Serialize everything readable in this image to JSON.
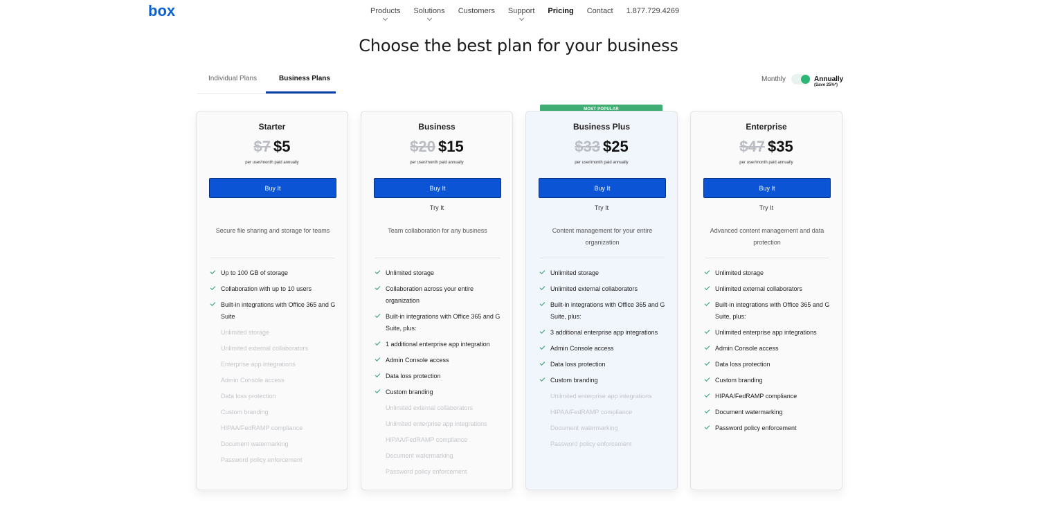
{
  "header": {
    "logo_text": "box",
    "nav": [
      {
        "label": "Products",
        "dropdown": true
      },
      {
        "label": "Solutions",
        "dropdown": true
      },
      {
        "label": "Customers",
        "dropdown": false
      },
      {
        "label": "Support",
        "dropdown": true
      },
      {
        "label": "Pricing",
        "dropdown": false,
        "active": true
      },
      {
        "label": "Contact",
        "dropdown": false
      },
      {
        "label": "1.877.729.4269",
        "dropdown": false
      }
    ]
  },
  "page_title": "Choose the best plan for your business",
  "tabs": [
    {
      "label": "Individual Plans",
      "active": false
    },
    {
      "label": "Business Plans",
      "active": true
    }
  ],
  "billing": {
    "monthly_label": "Monthly",
    "annually_label": "Annually",
    "save_note": "(Save 25%*)",
    "selected": "annually"
  },
  "colors": {
    "accent_blue": "#0b54d6",
    "tab_underline": "#0b3fa8",
    "toggle_green": "#2bb673",
    "badge_green": "#3fad74",
    "check_green": "#2a9c68"
  },
  "plans": [
    {
      "name": "Starter",
      "old_price": "$7",
      "price": "$5",
      "per": "per user/month paid annually",
      "buy_label": "Buy It",
      "try_label": "",
      "description": "Secure file sharing and storage for teams",
      "features": [
        {
          "text": "Up to 100 GB of storage",
          "included": true
        },
        {
          "text": "Collaboration with up to 10 users",
          "included": true
        },
        {
          "text": "Built-in integrations with Office 365 and G Suite",
          "included": true
        },
        {
          "text": "Unlimited storage",
          "included": false
        },
        {
          "text": "Unlimited external collaborators",
          "included": false
        },
        {
          "text": "Enterprise app integrations",
          "included": false
        },
        {
          "text": "Admin Console access",
          "included": false
        },
        {
          "text": "Data loss protection",
          "included": false
        },
        {
          "text": "Custom branding",
          "included": false
        },
        {
          "text": "HIPAA/FedRAMP compliance",
          "included": false
        },
        {
          "text": "Document watermarking",
          "included": false
        },
        {
          "text": "Password policy enforcement",
          "included": false
        }
      ]
    },
    {
      "name": "Business",
      "old_price": "$20",
      "price": "$15",
      "per": "per user/month paid annually",
      "buy_label": "Buy It",
      "try_label": "Try It",
      "description": "Team collaboration for any business",
      "features": [
        {
          "text": "Unlimited storage",
          "included": true
        },
        {
          "text": "Collaboration across your entire organization",
          "included": true
        },
        {
          "text": "Built-in integrations with Office 365 and G Suite, plus:",
          "included": true
        },
        {
          "text": "1 additional enterprise app integration",
          "included": true
        },
        {
          "text": "Admin Console access",
          "included": true
        },
        {
          "text": "Data loss protection",
          "included": true
        },
        {
          "text": "Custom branding",
          "included": true
        },
        {
          "text": "Unlimited external collaborators",
          "included": false
        },
        {
          "text": "Unlimited enterprise app integrations",
          "included": false
        },
        {
          "text": "HIPAA/FedRAMP compliance",
          "included": false
        },
        {
          "text": "Document watermarking",
          "included": false
        },
        {
          "text": "Password policy enforcement",
          "included": false
        }
      ]
    },
    {
      "name": "Business Plus",
      "badge": "MOST POPULAR",
      "old_price": "$33",
      "price": "$25",
      "per": "per user/month paid annually",
      "buy_label": "Buy It",
      "try_label": "Try It",
      "description": "Content management for your entire organization",
      "features": [
        {
          "text": "Unlimited storage",
          "included": true
        },
        {
          "text": "Unlimited external collaborators",
          "included": true
        },
        {
          "text": "Built-in integrations with Office 365 and G Suite, plus:",
          "included": true
        },
        {
          "text": "3 additional enterprise app integrations",
          "included": true
        },
        {
          "text": "Admin Console access",
          "included": true
        },
        {
          "text": "Data loss protection",
          "included": true
        },
        {
          "text": "Custom branding",
          "included": true
        },
        {
          "text": "Unlimited enterprise app integrations",
          "included": false
        },
        {
          "text": "HIPAA/FedRAMP compliance",
          "included": false
        },
        {
          "text": "Document watermarking",
          "included": false
        },
        {
          "text": "Password policy enforcement",
          "included": false
        }
      ]
    },
    {
      "name": "Enterprise",
      "old_price": "$47",
      "price": "$35",
      "per": "per user/month paid annually",
      "buy_label": "Buy It",
      "try_label": "Try It",
      "description": "Advanced content management and data protection",
      "features": [
        {
          "text": "Unlimited storage",
          "included": true
        },
        {
          "text": "Unlimited external collaborators",
          "included": true
        },
        {
          "text": "Built-in integrations with Office 365 and G Suite, plus:",
          "included": true
        },
        {
          "text": "Unlimited enterprise app integrations",
          "included": true
        },
        {
          "text": "Admin Console access",
          "included": true
        },
        {
          "text": "Data loss protection",
          "included": true
        },
        {
          "text": "Custom branding",
          "included": true
        },
        {
          "text": "HIPAA/FedRAMP compliance",
          "included": true
        },
        {
          "text": "Document watermarking",
          "included": true
        },
        {
          "text": "Password policy enforcement",
          "included": true
        }
      ]
    }
  ]
}
